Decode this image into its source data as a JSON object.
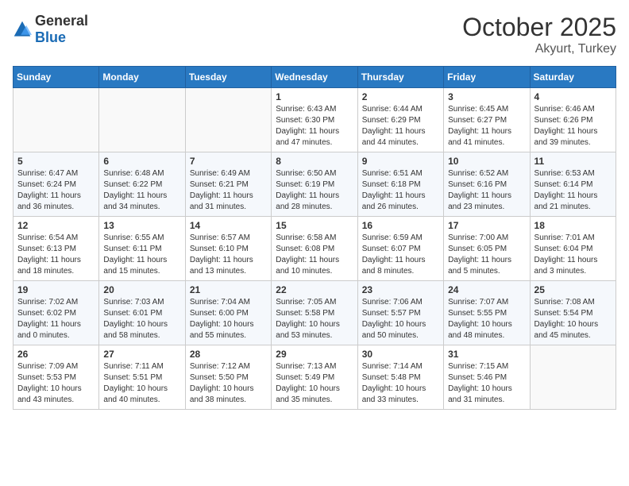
{
  "header": {
    "logo_general": "General",
    "logo_blue": "Blue",
    "month": "October 2025",
    "location": "Akyurt, Turkey"
  },
  "weekdays": [
    "Sunday",
    "Monday",
    "Tuesday",
    "Wednesday",
    "Thursday",
    "Friday",
    "Saturday"
  ],
  "weeks": [
    [
      {
        "day": "",
        "info": ""
      },
      {
        "day": "",
        "info": ""
      },
      {
        "day": "",
        "info": ""
      },
      {
        "day": "1",
        "info": "Sunrise: 6:43 AM\nSunset: 6:30 PM\nDaylight: 11 hours and 47 minutes."
      },
      {
        "day": "2",
        "info": "Sunrise: 6:44 AM\nSunset: 6:29 PM\nDaylight: 11 hours and 44 minutes."
      },
      {
        "day": "3",
        "info": "Sunrise: 6:45 AM\nSunset: 6:27 PM\nDaylight: 11 hours and 41 minutes."
      },
      {
        "day": "4",
        "info": "Sunrise: 6:46 AM\nSunset: 6:26 PM\nDaylight: 11 hours and 39 minutes."
      }
    ],
    [
      {
        "day": "5",
        "info": "Sunrise: 6:47 AM\nSunset: 6:24 PM\nDaylight: 11 hours and 36 minutes."
      },
      {
        "day": "6",
        "info": "Sunrise: 6:48 AM\nSunset: 6:22 PM\nDaylight: 11 hours and 34 minutes."
      },
      {
        "day": "7",
        "info": "Sunrise: 6:49 AM\nSunset: 6:21 PM\nDaylight: 11 hours and 31 minutes."
      },
      {
        "day": "8",
        "info": "Sunrise: 6:50 AM\nSunset: 6:19 PM\nDaylight: 11 hours and 28 minutes."
      },
      {
        "day": "9",
        "info": "Sunrise: 6:51 AM\nSunset: 6:18 PM\nDaylight: 11 hours and 26 minutes."
      },
      {
        "day": "10",
        "info": "Sunrise: 6:52 AM\nSunset: 6:16 PM\nDaylight: 11 hours and 23 minutes."
      },
      {
        "day": "11",
        "info": "Sunrise: 6:53 AM\nSunset: 6:14 PM\nDaylight: 11 hours and 21 minutes."
      }
    ],
    [
      {
        "day": "12",
        "info": "Sunrise: 6:54 AM\nSunset: 6:13 PM\nDaylight: 11 hours and 18 minutes."
      },
      {
        "day": "13",
        "info": "Sunrise: 6:55 AM\nSunset: 6:11 PM\nDaylight: 11 hours and 15 minutes."
      },
      {
        "day": "14",
        "info": "Sunrise: 6:57 AM\nSunset: 6:10 PM\nDaylight: 11 hours and 13 minutes."
      },
      {
        "day": "15",
        "info": "Sunrise: 6:58 AM\nSunset: 6:08 PM\nDaylight: 11 hours and 10 minutes."
      },
      {
        "day": "16",
        "info": "Sunrise: 6:59 AM\nSunset: 6:07 PM\nDaylight: 11 hours and 8 minutes."
      },
      {
        "day": "17",
        "info": "Sunrise: 7:00 AM\nSunset: 6:05 PM\nDaylight: 11 hours and 5 minutes."
      },
      {
        "day": "18",
        "info": "Sunrise: 7:01 AM\nSunset: 6:04 PM\nDaylight: 11 hours and 3 minutes."
      }
    ],
    [
      {
        "day": "19",
        "info": "Sunrise: 7:02 AM\nSunset: 6:02 PM\nDaylight: 11 hours and 0 minutes."
      },
      {
        "day": "20",
        "info": "Sunrise: 7:03 AM\nSunset: 6:01 PM\nDaylight: 10 hours and 58 minutes."
      },
      {
        "day": "21",
        "info": "Sunrise: 7:04 AM\nSunset: 6:00 PM\nDaylight: 10 hours and 55 minutes."
      },
      {
        "day": "22",
        "info": "Sunrise: 7:05 AM\nSunset: 5:58 PM\nDaylight: 10 hours and 53 minutes."
      },
      {
        "day": "23",
        "info": "Sunrise: 7:06 AM\nSunset: 5:57 PM\nDaylight: 10 hours and 50 minutes."
      },
      {
        "day": "24",
        "info": "Sunrise: 7:07 AM\nSunset: 5:55 PM\nDaylight: 10 hours and 48 minutes."
      },
      {
        "day": "25",
        "info": "Sunrise: 7:08 AM\nSunset: 5:54 PM\nDaylight: 10 hours and 45 minutes."
      }
    ],
    [
      {
        "day": "26",
        "info": "Sunrise: 7:09 AM\nSunset: 5:53 PM\nDaylight: 10 hours and 43 minutes."
      },
      {
        "day": "27",
        "info": "Sunrise: 7:11 AM\nSunset: 5:51 PM\nDaylight: 10 hours and 40 minutes."
      },
      {
        "day": "28",
        "info": "Sunrise: 7:12 AM\nSunset: 5:50 PM\nDaylight: 10 hours and 38 minutes."
      },
      {
        "day": "29",
        "info": "Sunrise: 7:13 AM\nSunset: 5:49 PM\nDaylight: 10 hours and 35 minutes."
      },
      {
        "day": "30",
        "info": "Sunrise: 7:14 AM\nSunset: 5:48 PM\nDaylight: 10 hours and 33 minutes."
      },
      {
        "day": "31",
        "info": "Sunrise: 7:15 AM\nSunset: 5:46 PM\nDaylight: 10 hours and 31 minutes."
      },
      {
        "day": "",
        "info": ""
      }
    ]
  ]
}
